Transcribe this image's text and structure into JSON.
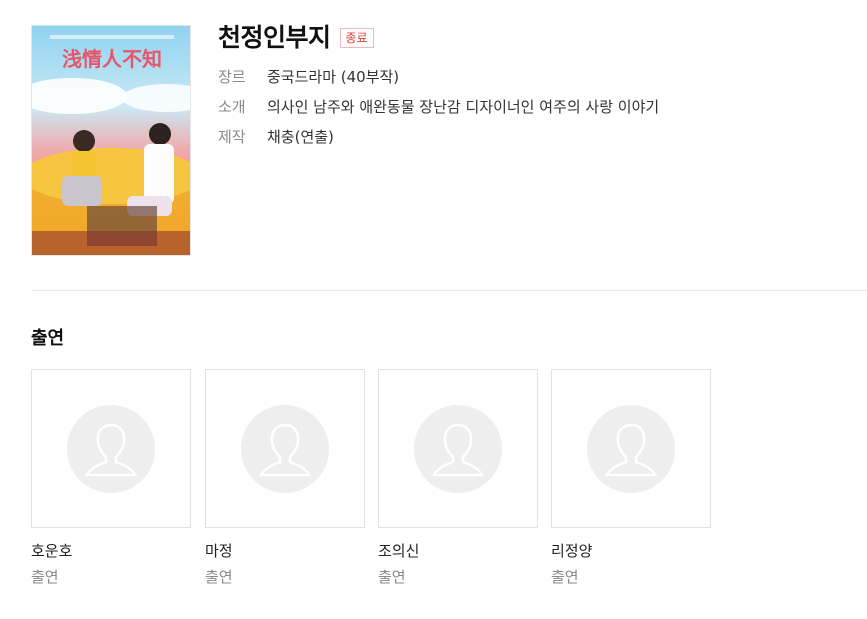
{
  "drama": {
    "title": "천정인부지",
    "status_badge": "종료",
    "poster_text": "浅情人不知",
    "info": [
      {
        "label": "장르",
        "value": "중국드라마 (40부작)"
      },
      {
        "label": "소개",
        "value": "의사인 남주와 애완동물 장난감 디자이너인 여주의 사랑 이야기"
      },
      {
        "label": "제작",
        "value": "채충(연출)"
      }
    ]
  },
  "cast_section": {
    "title": "출연",
    "members": [
      {
        "name": "호운호",
        "role": "출연",
        "photo_icon": "person-placeholder-icon"
      },
      {
        "name": "마정",
        "role": "출연",
        "photo_icon": "person-placeholder-icon"
      },
      {
        "name": "조의신",
        "role": "출연",
        "photo_icon": "person-placeholder-icon"
      },
      {
        "name": "리정양",
        "role": "출연",
        "photo_icon": "person-placeholder-icon"
      }
    ]
  },
  "colors": {
    "badge": "#d6423b",
    "label": "#8a8a8a",
    "placeholder": "#eeeeee"
  }
}
